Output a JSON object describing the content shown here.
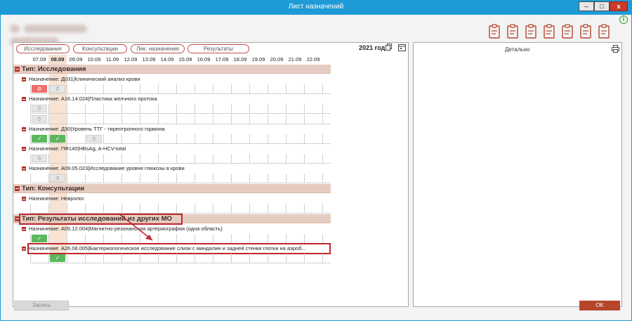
{
  "window": {
    "title": "Лист назначений",
    "min_label": "–",
    "max_label": "□",
    "close_label": "x"
  },
  "header": {
    "info_glyph": "i"
  },
  "toolbar": {
    "icons": [
      "clipboard-import-icon",
      "clipboard-list-icon",
      "clipboard-data-icon",
      "clipboard-check-icon",
      "clipboard-edit-icon",
      "clipboard-box-icon",
      "clipboard-user-icon"
    ]
  },
  "tabs": [
    {
      "label": "Исследования"
    },
    {
      "label": "Консультации"
    },
    {
      "label": "Лек. назначения"
    },
    {
      "label": "Результаты"
    }
  ],
  "year": "2021 год",
  "dates": [
    "07.09",
    "08.09",
    "09.09",
    "10.09",
    "11.09",
    "12.09",
    "13.09",
    "14.09",
    "15.09",
    "16.09",
    "17.09",
    "18.09",
    "19.09",
    "20.09",
    "21.09",
    "22.09"
  ],
  "today_index": 1,
  "groups": [
    {
      "label": "Тип: Исследования",
      "assignments": [
        {
          "label": "Назначение: Д031|Клинический анализ крови",
          "rows": [
            [
              {
                "i": 0,
                "s": "red",
                "g": "⊘"
              },
              {
                "i": 1,
                "s": "grey",
                "g": "⏱"
              }
            ]
          ]
        },
        {
          "label": "Назначение: А16.14.024|Пластика желчного протока",
          "rows": [
            [
              {
                "i": 0,
                "s": "grey",
                "g": "⏱"
              }
            ],
            [
              {
                "i": 0,
                "s": "grey",
                "g": "⏱"
              }
            ]
          ]
        },
        {
          "label": "Назначение: Д30|Уровень ТТГ - тиреотропного гормона",
          "rows": [
            [
              {
                "i": 0,
                "s": "green",
                "g": "✓"
              },
              {
                "i": 1,
                "s": "green",
                "g": "✓"
              },
              {
                "i": 3,
                "s": "grey",
                "g": "⏱"
              }
            ]
          ]
        },
        {
          "label": "Назначение: ПФ140|HBsAg, A-HCV-total",
          "rows": [
            [
              {
                "i": 0,
                "s": "grey",
                "g": "⏱"
              }
            ]
          ]
        },
        {
          "label": "Назначение: А09.05.023|Исследование уровня глюкозы в крови",
          "rows": [
            [
              {
                "i": 1,
                "s": "grey",
                "g": "⏱"
              }
            ]
          ]
        }
      ]
    },
    {
      "label": "Тип: Консультации",
      "assignments": [
        {
          "label": "Назначение: Невролог",
          "rows": [
            []
          ]
        }
      ]
    },
    {
      "label": "Тип: Результаты исследований из других МО",
      "assignments": [
        {
          "label": "Назначение: А05.12.004|Магнитно-резонансная артериография (одна область)",
          "rows": [
            [
              {
                "i": 0,
                "s": "green",
                "g": "✓"
              }
            ]
          ]
        },
        {
          "label": "Назначение: А26.08.005|Бактериологическое исследование слизи с миндалин и задней стенки глотки на аэроб...",
          "rows": [
            [
              {
                "i": 1,
                "s": "green",
                "g": "✓"
              }
            ]
          ]
        }
      ]
    }
  ],
  "detail_panel": {
    "title": "Детально"
  },
  "buttons": {
    "save": "Запись",
    "ok": "OK"
  },
  "colors": {
    "titlebar": "#1e9bd7",
    "accent": "#b5462c",
    "type_row": "#e6ccc0",
    "today_column": "#f6e3d4",
    "status_done": "#5cb85c",
    "status_cancel": "#f06e70",
    "highlight": "#c0272d"
  }
}
